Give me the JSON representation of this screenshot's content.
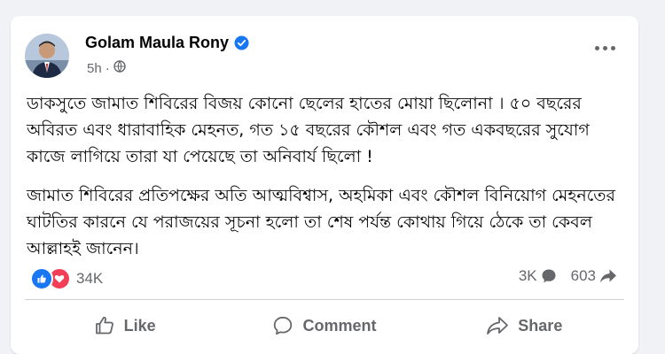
{
  "post": {
    "author": "Golam Maula Rony",
    "time": "5h",
    "dot": "·",
    "paragraphs": [
      "ডাকসুতে জামাত শিবিরের বিজয় কোনো ছেলের হাতের মোয়া ছিলোনা । ৫০ বছরের অবিরত এবং ধারাবাহিক মেহনত, গত ১৫ বছরের কৌশল এবং গত একবছরের সুযোগ কাজে লাগিয়ে তারা যা পেয়েছে তা অনিবার্য ছিলো !",
      "জামাত শিবিরের প্রতিপক্ষের অতি আত্মবিশ্বাস, অহমিকা এবং কৌশল বিনিয়োগ মেহনতের ঘাটতির কারনে যে পরাজয়ের সূচনা হলো তা শেষ পর্যন্ত কোথায় গিয়ে ঠেকে তা কেবল আল্লাহই জানেন।"
    ]
  },
  "stats": {
    "reactions": "34K",
    "comments": "3K",
    "shares": "603"
  },
  "actions": {
    "like": "Like",
    "comment": "Comment",
    "share": "Share"
  },
  "icons": {
    "verified": "verified-badge-icon",
    "privacy": "globe-icon",
    "more": "more-options-icon",
    "like_reaction": "like-reaction-icon",
    "love_reaction": "love-reaction-icon",
    "comment": "comment-icon",
    "share": "share-icon"
  },
  "colors": {
    "accent": "#1877f2",
    "love": "#f33e58",
    "secondary_text": "#65676b"
  }
}
